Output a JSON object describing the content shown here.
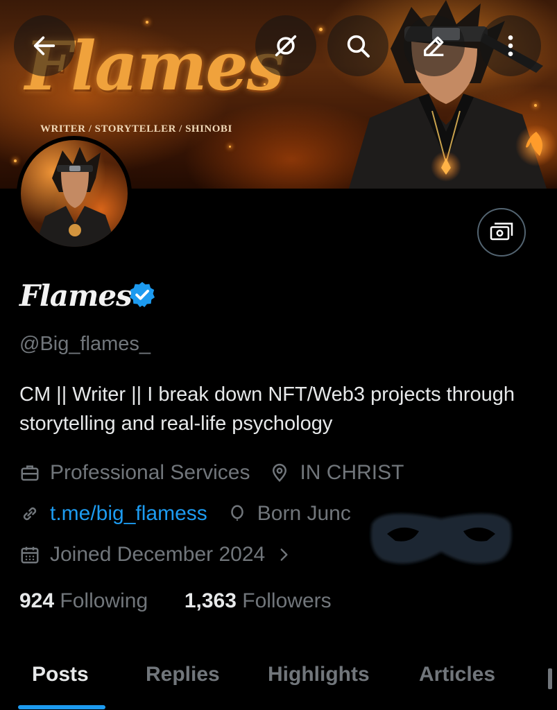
{
  "banner": {
    "title": "Flames",
    "subtitle": "WRITER / STORYTELLER / SHINOBI"
  },
  "toolbar": {
    "back_icon": "arrow-left-icon",
    "grok_icon": "grok-icon",
    "search_icon": "search-icon",
    "edit_icon": "pencil-icon",
    "more_icon": "more-vertical-icon"
  },
  "profile": {
    "display_name": "Flames",
    "verified": true,
    "handle": "@Big_flames_",
    "bio": "CM || Writer || I break down NFT/Web3 projects through storytelling and real-life psychology",
    "category": "Professional Services",
    "location": "IN CHRIST",
    "website": "t.me/big_flamess",
    "birthday": "Born Junc",
    "joined": "Joined December 2024",
    "following_count": "924",
    "following_label": "Following",
    "followers_count": "1,363",
    "followers_label": "Followers"
  },
  "tabs": [
    {
      "label": "Posts",
      "active": true
    },
    {
      "label": "Replies",
      "active": false
    },
    {
      "label": "Highlights",
      "active": false
    },
    {
      "label": "Articles",
      "active": false
    }
  ],
  "colors": {
    "accent": "#1d9bf0",
    "background": "#000000",
    "muted": "#71767b",
    "text": "#e7e9ea"
  }
}
